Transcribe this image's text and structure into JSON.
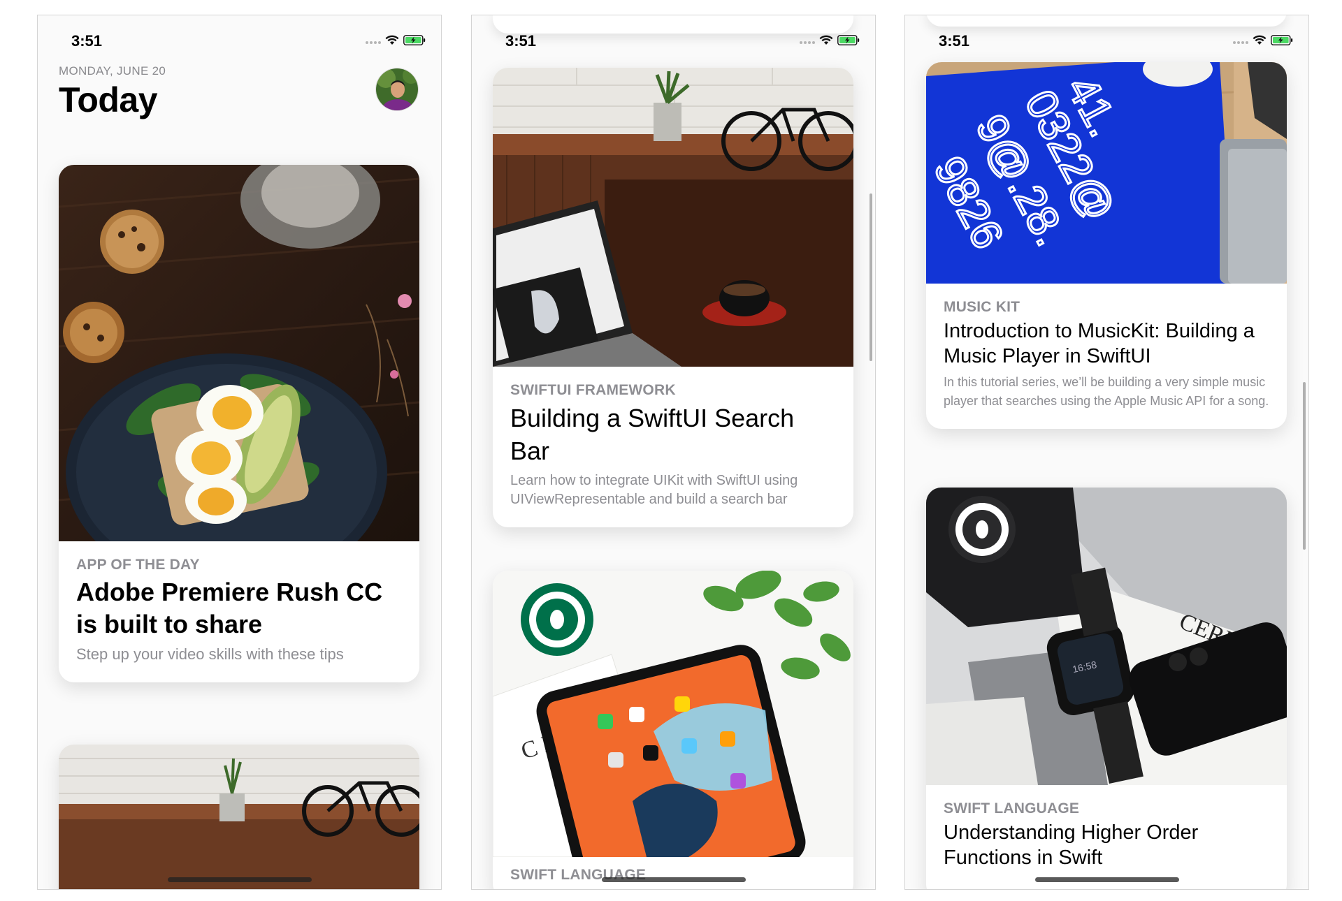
{
  "status_bar": {
    "time": "3:51"
  },
  "colors": {
    "brand_blue": "#1235d6",
    "category_gray": "#8e8e93",
    "starbucks_green": "#00704a"
  },
  "screen1": {
    "date": "MONDAY, JUNE 20",
    "title": "Today",
    "cards": [
      {
        "category": "APP OF THE DAY",
        "title": "Adobe Premiere Rush CC is built to share",
        "subtitle": "Step up your video skills with these tips"
      }
    ]
  },
  "screen2": {
    "cards": [
      {
        "category": "SWIFTUI FRAMEWORK",
        "title": "Building a SwiftUI Search Bar",
        "subtitle": "Learn how to integrate UIKit with SwiftUI using UIViewRepresentable and build a search bar"
      },
      {
        "category": "SWIFT LANGUAGE"
      }
    ]
  },
  "screen3": {
    "cards": [
      {
        "category": "MUSIC KIT",
        "title": "Introduction to MusicKit: Building a Music Player in SwiftUI",
        "subtitle": "In this tutorial series, we’ll be building a very simple music player that searches using the Apple Music API for a song."
      },
      {
        "category": "SWIFT LANGUAGE",
        "title": "Understanding Higher Order Functions in Swift",
        "image_text": "CEREAL"
      }
    ]
  }
}
